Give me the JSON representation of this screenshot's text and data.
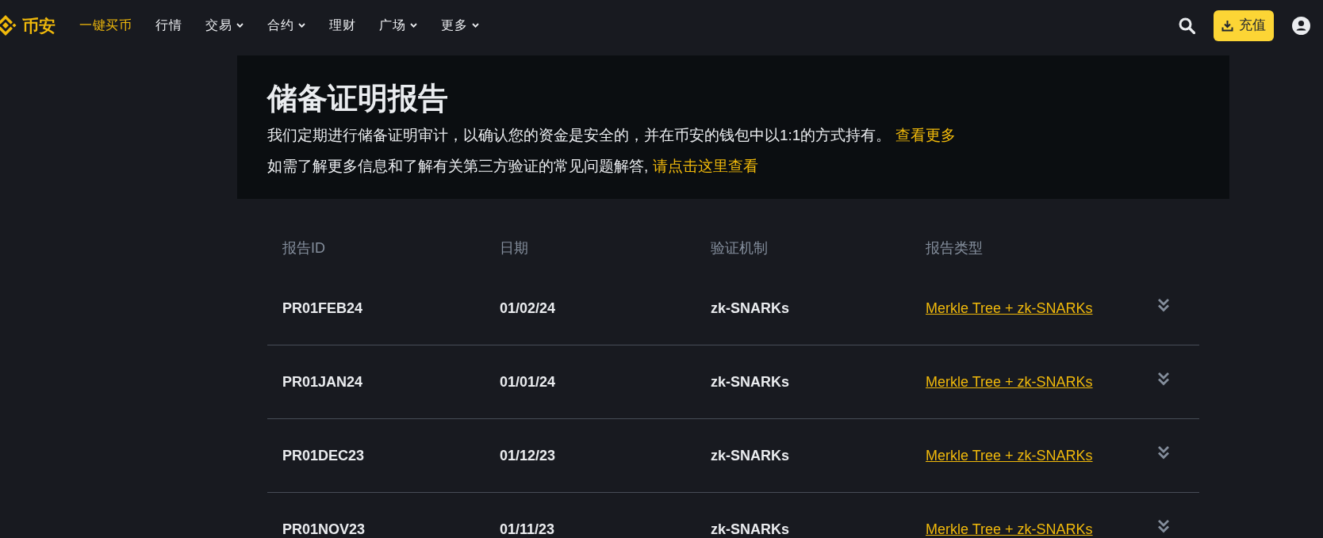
{
  "nav": {
    "logo": "币安",
    "items": [
      {
        "label": "一键买币",
        "highlighted": true,
        "dropdown": false
      },
      {
        "label": "行情",
        "highlighted": false,
        "dropdown": false
      },
      {
        "label": "交易",
        "highlighted": false,
        "dropdown": true
      },
      {
        "label": "合约",
        "highlighted": false,
        "dropdown": true
      },
      {
        "label": "理财",
        "highlighted": false,
        "dropdown": false
      },
      {
        "label": "广场",
        "highlighted": false,
        "dropdown": true
      },
      {
        "label": "更多",
        "highlighted": false,
        "dropdown": true
      }
    ],
    "deposit_button": "充值"
  },
  "banner": {
    "title": "储备证明报告",
    "paragraphs": [
      {
        "text": "我们定期进行储备证明审计，以确认您的资金是安全的，并在币安的钱包中以1:1的方式持有。",
        "link": "查看更多"
      },
      {
        "text": "如需了解更多信息和了解有关第三方验证的常见问题解答,",
        "link": "请点击这里查看"
      }
    ]
  },
  "table": {
    "columns": [
      "报告ID",
      "日期",
      "验证机制",
      "报告类型"
    ],
    "rows": [
      {
        "report_id": "PR01FEB24",
        "date": "01/02/24",
        "mechanism": "zk-SNARKs",
        "report_type": "Merkle Tree + zk-SNARKs",
        "expanded": false
      },
      {
        "report_id": "PR01JAN24",
        "date": "01/01/24",
        "mechanism": "zk-SNARKs",
        "report_type": "Merkle Tree + zk-SNARKs",
        "expanded": false
      },
      {
        "report_id": "PR01DEC23",
        "date": "01/12/23",
        "mechanism": "zk-SNARKs",
        "report_type": "Merkle Tree + zk-SNARKs",
        "expanded": false
      },
      {
        "report_id": "PR01NOV23",
        "date": "01/11/23",
        "mechanism": "zk-SNARKs",
        "report_type": "Merkle Tree + zk-SNARKs",
        "expanded": false
      }
    ]
  }
}
